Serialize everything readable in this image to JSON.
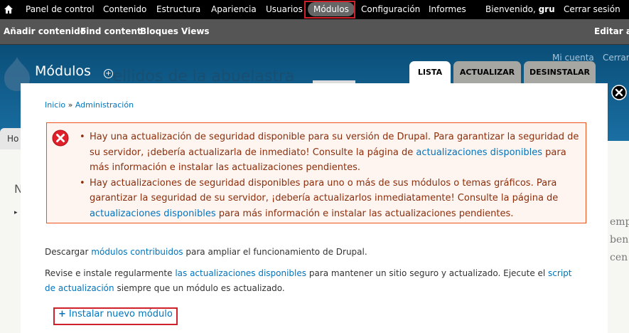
{
  "toolbar": {
    "items": [
      {
        "label": "Panel de control"
      },
      {
        "label": "Contenido"
      },
      {
        "label": "Estructura"
      },
      {
        "label": "Apariencia"
      },
      {
        "label": "Usuarios"
      },
      {
        "label": "Módulos"
      },
      {
        "label": "Configuración"
      },
      {
        "label": "Informes"
      }
    ],
    "welcome_prefix": "Bienvenido,",
    "welcome_user": "gru",
    "logout": "Cerrar sesión"
  },
  "shortcuts": {
    "items": [
      {
        "label": "Añadir contenido"
      },
      {
        "label": "Find content"
      },
      {
        "label": "Bloques"
      },
      {
        "label": "Views"
      }
    ],
    "edit": "Editar at"
  },
  "background": {
    "site_name": "rellidos de la abuelastra",
    "my_account": "Mi cuenta",
    "logout": "Cerrar",
    "tab": "Ho"
  },
  "overlay": {
    "title": "Módulos",
    "tabs": [
      {
        "label": "LISTA"
      },
      {
        "label": "ACTUALIZAR"
      },
      {
        "label": "DESINSTALAR"
      }
    ],
    "breadcrumb": {
      "home": "Inicio",
      "separator": " » ",
      "admin": "Administración"
    },
    "errors": [
      {
        "before": "Hay una actualización de seguridad disponible para su versión de Drupal. Para garantizar la seguridad de su servidor, ¡debería actualizarla de inmediato! Consulte la página de ",
        "link": "actualizaciones disponibles",
        "after": " para más información e instalar las actualizaciones pendientes."
      },
      {
        "before": "Hay actualizaciones de seguridad disponibles para uno o más de sus módulos o temas gráficos. Para garantizar la seguridad de su servidor, ¡debería actualizarlos inmediatamente! Consulte la página de ",
        "link": "actualizaciones disponibles",
        "after": " para más información e instalar las actualizaciones pendientes."
      }
    ],
    "para1": {
      "before": "Descargar ",
      "link": "módulos contribuidos",
      "after": " para ampliar el funcionamiento de Drupal."
    },
    "para2": {
      "before": "Revise e instale regularmente ",
      "link1": "las actualizaciones disponibles",
      "middle": " para mantener un sitio seguro y actualizado. Ejecute el ",
      "link2": "script de actualización",
      "after": " siempre que un módulo es actualizado."
    },
    "install_link": "Instalar nuevo módulo"
  },
  "colors": {
    "toolbar_bg": "#000000",
    "shortcuts_bg": "#555555",
    "link": "#0074bd",
    "error_text": "#8c2e0b",
    "error_border": "#ed541d",
    "error_bg": "#fef5f1",
    "highlight": "#d0202a"
  }
}
